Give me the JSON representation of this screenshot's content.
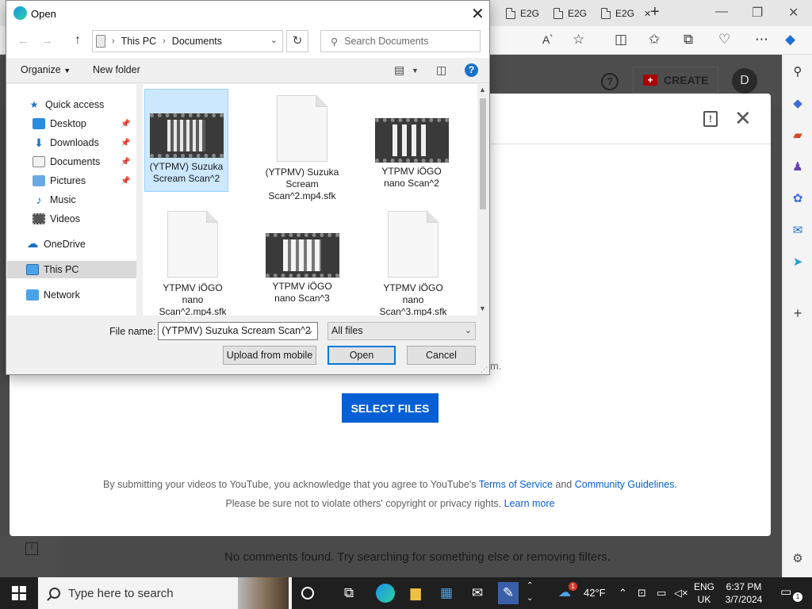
{
  "browser": {
    "tabs": [
      {
        "label": "E2G"
      },
      {
        "label": "E2G"
      },
      {
        "label": "E2G"
      }
    ]
  },
  "youtube": {
    "create_label": "CREATE",
    "avatar_letter": "D",
    "behind_fragment": "m.",
    "select_files_label": "SELECT FILES",
    "legal_line1_prefix": "By submitting your videos to YouTube, you acknowledge that you agree to YouTube's ",
    "terms_link": "Terms of Service",
    "legal_and": " and ",
    "guidelines_link": "Community Guidelines",
    "legal_period": ".",
    "legal_line2_prefix": "Please be sure not to violate others' copyright or privacy rights. ",
    "learn_more_link": "Learn more",
    "comments_empty": "No comments found. Try searching for something else or removing filters."
  },
  "open_dialog": {
    "title": "Open",
    "breadcrumb": [
      "This PC",
      "Documents"
    ],
    "search_placeholder": "Search Documents",
    "organize_label": "Organize",
    "new_folder_label": "New folder",
    "nav_tree": [
      {
        "label": "Quick access"
      },
      {
        "label": "Desktop"
      },
      {
        "label": "Downloads"
      },
      {
        "label": "Documents"
      },
      {
        "label": "Pictures"
      },
      {
        "label": "Music"
      },
      {
        "label": "Videos"
      },
      {
        "label": "OneDrive"
      },
      {
        "label": "This PC"
      },
      {
        "label": "Network"
      }
    ],
    "files": [
      {
        "line1": "(YTPMV) Suzuka",
        "line2": "Scream Scan^2",
        "line3": ""
      },
      {
        "line1": "(YTPMV) Suzuka",
        "line2": "Scream",
        "line3": "Scan^2.mp4.sfk"
      },
      {
        "line1": "YTPMV iÖGO",
        "line2": "nano Scan^2",
        "line3": ""
      },
      {
        "line1": "YTPMV iÖGO",
        "line2": "nano",
        "line3": "Scan^2.mp4.sfk"
      },
      {
        "line1": "YTPMV iÖGO",
        "line2": "nano Scan^3",
        "line3": ""
      },
      {
        "line1": "YTPMV iÖGO",
        "line2": "nano",
        "line3": "Scan^3.mp4.sfk"
      }
    ],
    "file_name_label": "File name:",
    "file_name_value": "(YTPMV) Suzuka Scream Scan^2",
    "file_type_value": "All files",
    "upload_mobile_label": "Upload from mobile",
    "open_label": "Open",
    "cancel_label": "Cancel"
  },
  "taskbar": {
    "search_placeholder": "Type here to search",
    "weather_temp": "42°F",
    "weather_badge": "1",
    "lang_line1": "ENG",
    "lang_line2": "UK",
    "time": "6:37 PM",
    "date": "3/7/2024",
    "notification_count": "1"
  },
  "colors": {
    "yt_blue": "#065fd4",
    "selection_bg": "#cce8ff",
    "dialog_accent": "#0078d7"
  }
}
